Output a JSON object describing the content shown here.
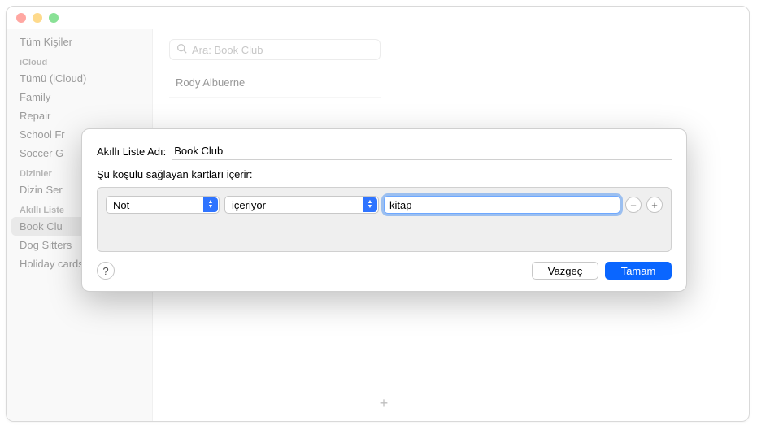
{
  "sidebar": {
    "all": "Tüm Kişiler",
    "sections": {
      "icloud": {
        "title": "iCloud",
        "items": [
          "Tümü (iCloud)",
          "Family",
          "Repair",
          "School Fr",
          "Soccer G"
        ]
      },
      "directories": {
        "title": "Dizinler",
        "items": [
          "Dizin Ser"
        ]
      },
      "smartlists": {
        "title": "Akıllı Liste",
        "items": [
          "Book Clu",
          "Dog Sitters",
          "Holiday cards"
        ]
      }
    }
  },
  "search": {
    "placeholder": "Ara: Book Club"
  },
  "contacts": {
    "rows": [
      "Rody Albuerne"
    ]
  },
  "sheet": {
    "name_label": "Akıllı Liste Adı:",
    "name_value": "Book Club",
    "subtitle": "Şu koşulu sağlayan kartları içerir:",
    "rule": {
      "field": "Not",
      "operator": "içeriyor",
      "value": "kitap"
    },
    "help": "?",
    "cancel": "Vazgeç",
    "ok": "Tamam"
  },
  "icons": {
    "remove": "−",
    "add": "+",
    "plus_footer": "+"
  }
}
